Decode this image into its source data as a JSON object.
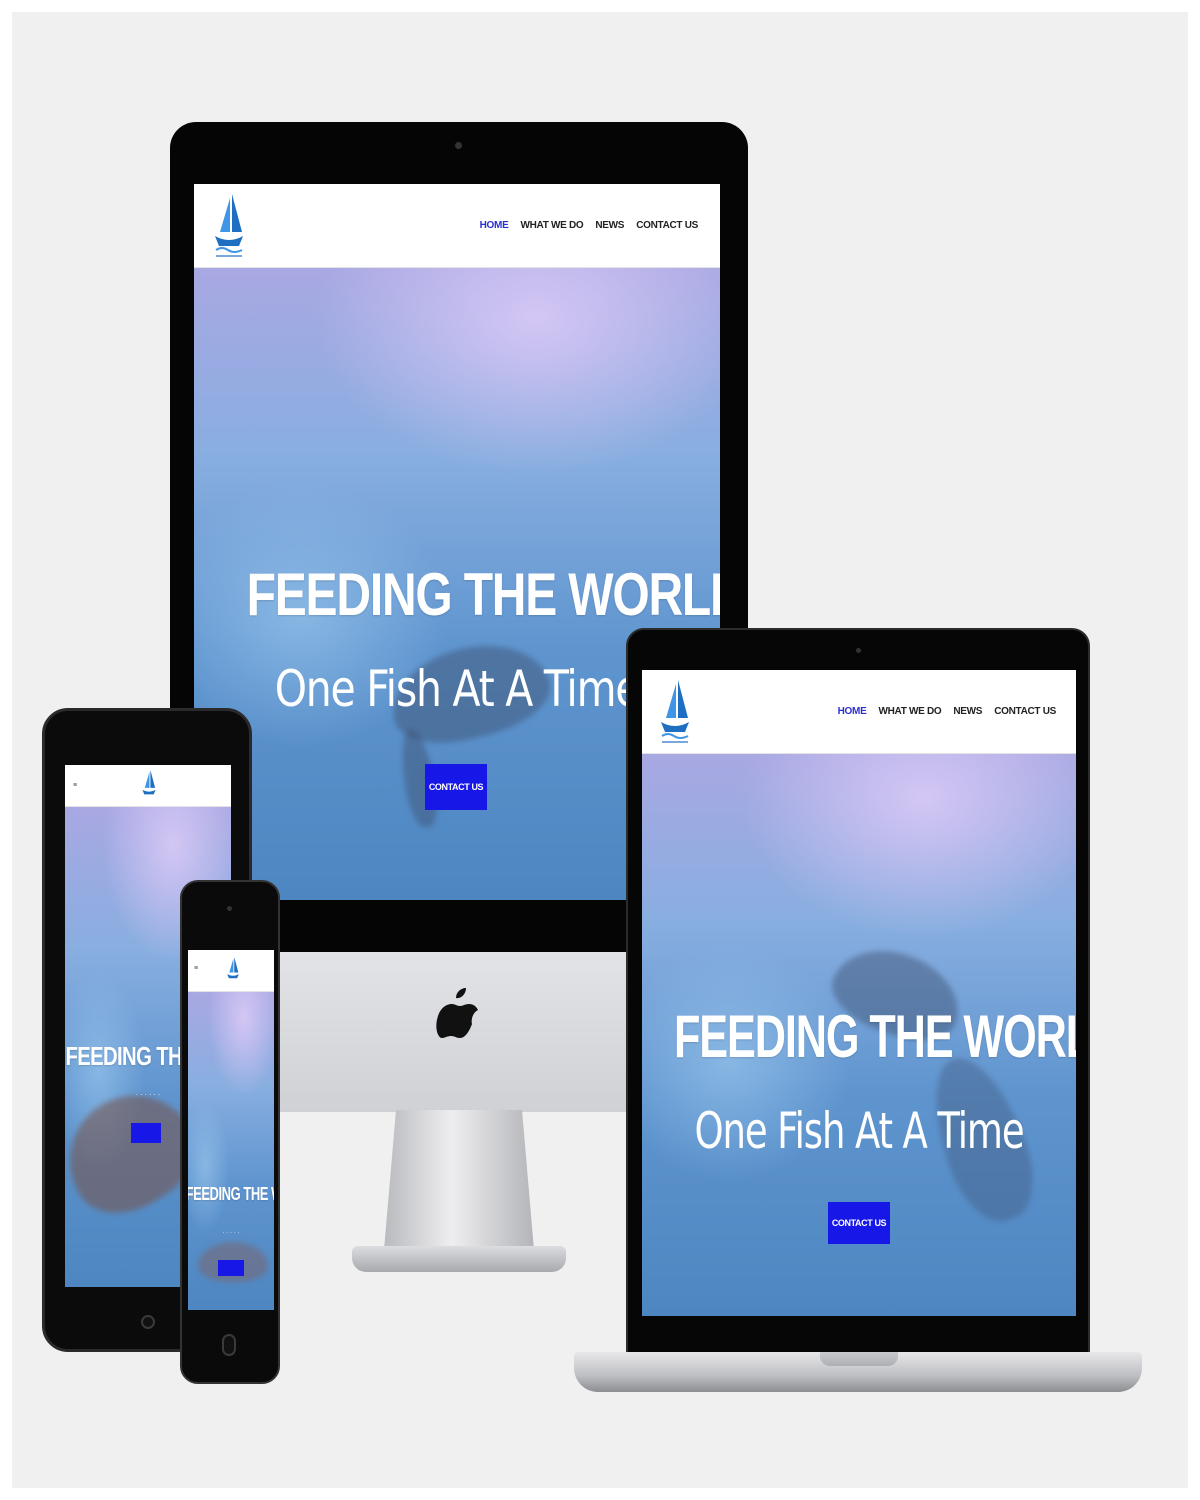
{
  "site": {
    "nav": [
      "HOME",
      "WHAT WE DO",
      "NEWS",
      "CONTACT US"
    ],
    "headline": "FEEDING THE WORLD!",
    "tagline": "One Fish At A Time",
    "cta_label": "CONTACT US",
    "tablet_headline": "FEEDING THE W",
    "phone_headline": "FEEDING THE WORLD"
  },
  "icons": {
    "logo": "sailboat-logo-icon",
    "device_brand": "apple-logo-icon",
    "mobile_menu": "hamburger-menu-icon"
  },
  "colors": {
    "nav_active": "#2b2fd6",
    "cta_background": "#1717e8",
    "ocean": "#5f95cf",
    "device_frame": "#050505"
  }
}
